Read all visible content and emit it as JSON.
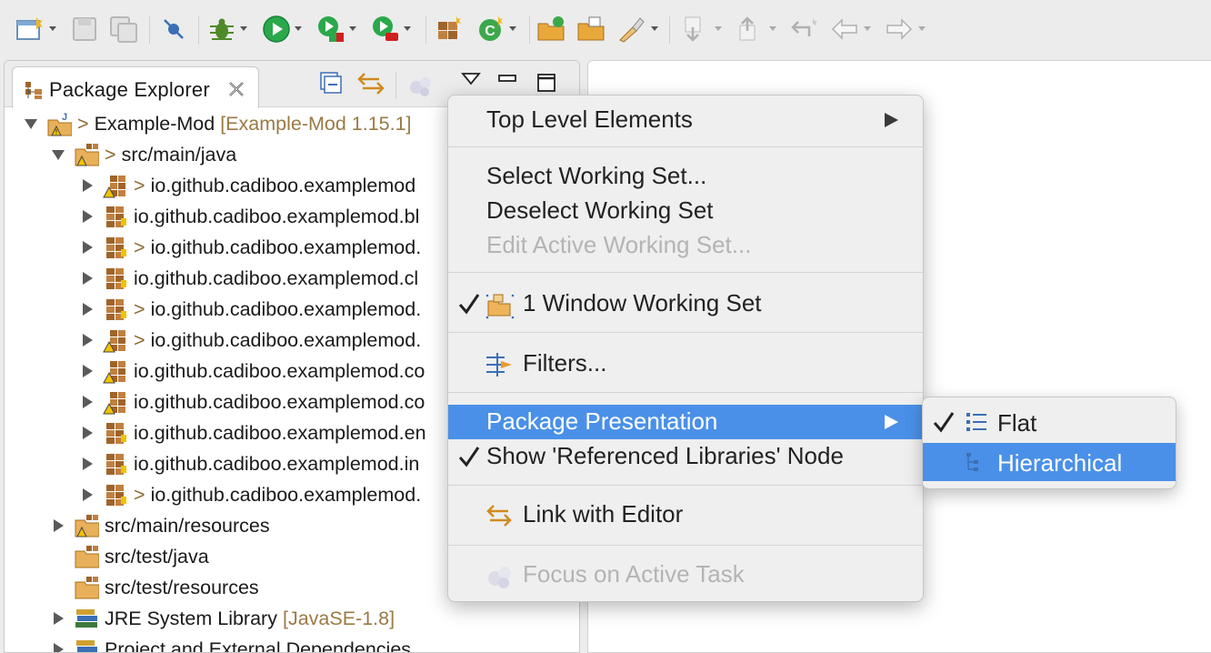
{
  "colors": {
    "accent": "#4a90e8",
    "decoration": "#9a7a45",
    "run_green": "#2aa84a",
    "package_brown": "#a0642a"
  },
  "toolbar": {
    "icons": [
      "new-wizard-icon",
      "save-icon",
      "save-all-icon",
      "skip-breakpoints-icon",
      "debug-icon",
      "run-icon",
      "coverage-icon",
      "external-tools-icon",
      "new-java-package-icon",
      "new-java-class-icon",
      "open-type-icon",
      "open-task-icon",
      "search-icon",
      "next-annotation-icon",
      "previous-annotation-icon",
      "last-edit-location-icon",
      "back-icon",
      "forward-icon"
    ]
  },
  "explorer": {
    "tab_title": "Package Explorer",
    "header_buttons": [
      "collapse-all-icon",
      "link-with-editor-icon",
      "focus-task-icon",
      "view-menu-icon",
      "minimize-icon",
      "maximize-icon"
    ]
  },
  "tree": [
    {
      "label": "Example-Mod",
      "decoration": "[Example-Mod 1.15.1]",
      "prefix": ">",
      "expanded": true,
      "icon": "java-project-icon",
      "level": 0
    },
    {
      "label": "src/main/java",
      "prefix": ">",
      "expanded": true,
      "icon": "source-folder-icon",
      "level": 1
    },
    {
      "label": "io.github.cadiboo.examplemod",
      "prefix": ">",
      "icon": "package-warning-icon",
      "level": 2
    },
    {
      "label": "io.github.cadiboo.examplemod.bl",
      "prefix": "",
      "icon": "package-icon",
      "level": 2
    },
    {
      "label": "io.github.cadiboo.examplemod.",
      "prefix": ">",
      "icon": "package-icon",
      "level": 2
    },
    {
      "label": "io.github.cadiboo.examplemod.cl",
      "prefix": "",
      "icon": "package-icon",
      "level": 2
    },
    {
      "label": "io.github.cadiboo.examplemod.",
      "prefix": ">",
      "icon": "package-icon",
      "level": 2
    },
    {
      "label": "io.github.cadiboo.examplemod.",
      "prefix": ">",
      "icon": "package-warning-icon",
      "level": 2
    },
    {
      "label": "io.github.cadiboo.examplemod.co",
      "prefix": "",
      "icon": "package-warning-icon",
      "level": 2
    },
    {
      "label": "io.github.cadiboo.examplemod.co",
      "prefix": "",
      "icon": "package-warning-icon",
      "level": 2
    },
    {
      "label": "io.github.cadiboo.examplemod.en",
      "prefix": "",
      "icon": "package-icon",
      "level": 2
    },
    {
      "label": "io.github.cadiboo.examplemod.in",
      "prefix": "",
      "icon": "package-icon",
      "level": 2
    },
    {
      "label": "io.github.cadiboo.examplemod.",
      "prefix": ">",
      "icon": "package-icon",
      "level": 2
    },
    {
      "label": "src/main/resources",
      "prefix": "",
      "collapsed": true,
      "icon": "source-folder-warning-icon",
      "level": 1
    },
    {
      "label": "src/test/java",
      "prefix": "",
      "icon": "source-folder-icon",
      "level": 1
    },
    {
      "label": "src/test/resources",
      "prefix": "",
      "icon": "source-folder-icon",
      "level": 1
    },
    {
      "label": "JRE System Library",
      "decoration": "[JavaSE-1.8]",
      "prefix": "",
      "collapsed": true,
      "icon": "library-icon",
      "level": 1
    },
    {
      "label": "Project and External Dependencies",
      "prefix": "",
      "collapsed": true,
      "icon": "library-icon",
      "level": 1
    }
  ],
  "menu": {
    "items": [
      {
        "label": "Top Level Elements",
        "submenu": true
      },
      {
        "label": "Select Working Set..."
      },
      {
        "label": "Deselect Working Set"
      },
      {
        "label": "Edit Active Working Set...",
        "disabled": true
      },
      {
        "label": "1 Window Working Set",
        "checked": true,
        "icon": "working-set-icon"
      },
      {
        "label": "Filters...",
        "icon": "filters-icon"
      },
      {
        "label": "Package Presentation",
        "submenu": true,
        "highlighted": true
      },
      {
        "label": "Show 'Referenced Libraries' Node",
        "checked": true
      },
      {
        "label": "Link with Editor",
        "icon": "link-editor-icon"
      },
      {
        "label": "Focus on Active Task",
        "icon": "focus-task-icon",
        "disabled": true
      }
    ]
  },
  "submenu": {
    "items": [
      {
        "label": "Flat",
        "checked": true,
        "icon": "flat-layout-icon"
      },
      {
        "label": "Hierarchical",
        "highlighted": true,
        "icon": "hierarchical-layout-icon"
      }
    ]
  }
}
